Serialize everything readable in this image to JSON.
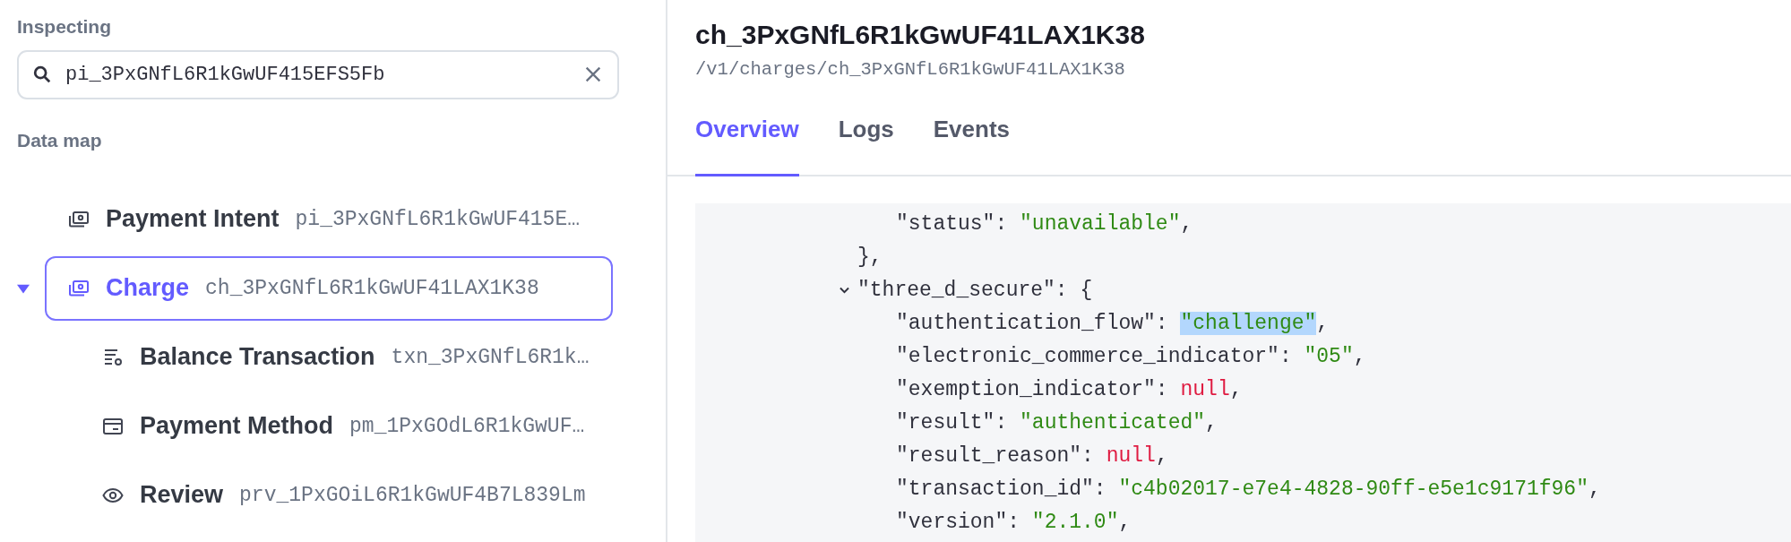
{
  "sidebar": {
    "inspecting_label": "Inspecting",
    "search": {
      "value": "pi_3PxGNfL6R1kGwUF415EFS5Fb"
    },
    "data_map_label": "Data map",
    "items": [
      {
        "kind": "money",
        "label": "Payment Intent",
        "id": "pi_3PxGNfL6R1kGwUF415E…",
        "selected": false
      },
      {
        "kind": "money",
        "label": "Charge",
        "id": "ch_3PxGNfL6R1kGwUF41LAX1K38",
        "selected": true,
        "expanded": true,
        "children": [
          {
            "kind": "transaction",
            "label": "Balance Transaction",
            "id": "txn_3PxGNfL6R1k…",
            "selected": false
          },
          {
            "kind": "method",
            "label": "Payment Method",
            "id": "pm_1PxGOdL6R1kGwUF…",
            "selected": false
          },
          {
            "kind": "review",
            "label": "Review",
            "id": "prv_1PxGOiL6R1kGwUF4B7L839Lm",
            "selected": false
          }
        ]
      }
    ]
  },
  "detail": {
    "title": "ch_3PxGNfL6R1kGwUF41LAX1K38",
    "path": "/v1/charges/ch_3PxGNfL6R1kGwUF41LAX1K38",
    "tabs": [
      {
        "label": "Overview",
        "selected": true
      },
      {
        "label": "Logs",
        "selected": false
      },
      {
        "label": "Events",
        "selected": false
      }
    ],
    "code": {
      "lines": [
        {
          "children": [
            {
              "key": "\"status\"",
              "sep": ":",
              "value": "\"unavailable\"",
              "kind": "string",
              "end": ",",
              "highlighted": false
            }
          ]
        },
        {
          "value": "}",
          "kind": "brace",
          "end": ",",
          "highlighted": false
        },
        {
          "key": "\"three_d_secure\"",
          "sep": ":",
          "value": "{",
          "kind": "brace",
          "highlighted": false,
          "expanded": true,
          "children": [
            {
              "key": "\"authentication_flow\"",
              "sep": ":",
              "value": "\"challenge\"",
              "kind": "string",
              "end": ",",
              "highlighted": true
            },
            {
              "key": "\"electronic_commerce_indicator\"",
              "sep": ":",
              "value": "\"05\"",
              "kind": "string",
              "end": ",",
              "highlighted": false
            },
            {
              "key": "\"exemption_indicator\"",
              "sep": ":",
              "value": "null",
              "kind": "null",
              "end": ",",
              "highlighted": false
            },
            {
              "key": "\"result\"",
              "sep": ":",
              "value": "\"authenticated\"",
              "kind": "string",
              "end": ",",
              "highlighted": false
            },
            {
              "key": "\"result_reason\"",
              "sep": ":",
              "value": "null",
              "kind": "null",
              "end": ",",
              "highlighted": false
            },
            {
              "key": "\"transaction_id\"",
              "sep": ":",
              "value": "\"c4b02017-e7e4-4828-90ff-e5e1c9171f96\"",
              "kind": "string",
              "end": ",",
              "highlighted": false
            },
            {
              "key": "\"version\"",
              "sep": ":",
              "value": "\"2.1.0\"",
              "kind": "string",
              "end": ",",
              "highlighted": false
            }
          ]
        }
      ]
    }
  }
}
